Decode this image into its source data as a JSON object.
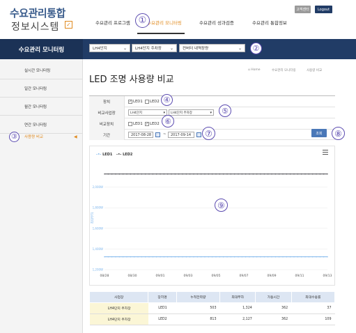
{
  "header": {
    "logo_line1": "수요관리통합",
    "logo_line2": "정보시스템",
    "nav": [
      "수요관리 프로그램",
      "수요관리 모니터링",
      "수요관리 성과검증",
      "수요관리 통합정보"
    ],
    "active_nav": 1,
    "btn_myinfo": "고객센터",
    "btn_logout": "Logout"
  },
  "bar": {
    "title": "수요관리 모니터링",
    "select1": "LH4단지",
    "select2": "LH4단지 주차장",
    "select3": "컨버터 내역장량"
  },
  "sidebar": {
    "items": [
      "실시간 모니터링",
      "일간 모니터링",
      "월간 모니터링",
      "연간 모니터링",
      "사용량 비교"
    ],
    "active": 4
  },
  "page": {
    "title": "LED 조명 사용량 비교",
    "breadcrumb": [
      "⌂ Home",
      "수요관리 모니터링",
      "사용량 비교"
    ]
  },
  "form": {
    "device_label": "장치",
    "device_opt1": "LED1",
    "device_opt2": "LED2",
    "site_label": "비교사업장",
    "site_sel1": "LH4단지",
    "site_sel2": "LH4단지 주차장",
    "cmp_label": "비교장치",
    "cmp_opt1": "LED1",
    "cmp_opt2": "LED2",
    "period_label": "기간",
    "date_from": "2017-08-28",
    "date_sep": "~",
    "date_to": "2017-09-14",
    "query_btn": "조회"
  },
  "callouts": [
    "①",
    "②",
    "③",
    "④",
    "⑤",
    "⑥",
    "⑦",
    "⑧",
    "⑨"
  ],
  "chart_data": {
    "type": "line",
    "x": [
      "08/28",
      "08/30",
      "09/01",
      "09/03",
      "09/05",
      "09/07",
      "09/09",
      "09/11",
      "09/13"
    ],
    "ylim": [
      1200,
      2200
    ],
    "yticks": [
      "1,200W",
      "1,400W",
      "1,600W",
      "1,800W",
      "2,000W"
    ],
    "ylabel": "최대부하",
    "series": [
      {
        "name": "LED1",
        "color": "#7cb5ec",
        "values": [
          1324,
          1324,
          1324,
          1324,
          1324,
          1324,
          1324,
          1324,
          1324
        ]
      },
      {
        "name": "LED2",
        "color": "#434348",
        "values": [
          2127,
          2127,
          2127,
          2127,
          2127,
          2127,
          2127,
          2127,
          2127
        ]
      }
    ]
  },
  "table": {
    "headers": [
      "사업장",
      "장치명",
      "누적전력량",
      "최대부하",
      "가동시간",
      "최대수용률"
    ],
    "rows": [
      [
        "LH4단지 주차장",
        "LED1",
        "503",
        "1,324",
        "362",
        "37"
      ],
      [
        "LH4단지 주차장",
        "LED2",
        "813",
        "2,127",
        "362",
        "109"
      ]
    ]
  }
}
